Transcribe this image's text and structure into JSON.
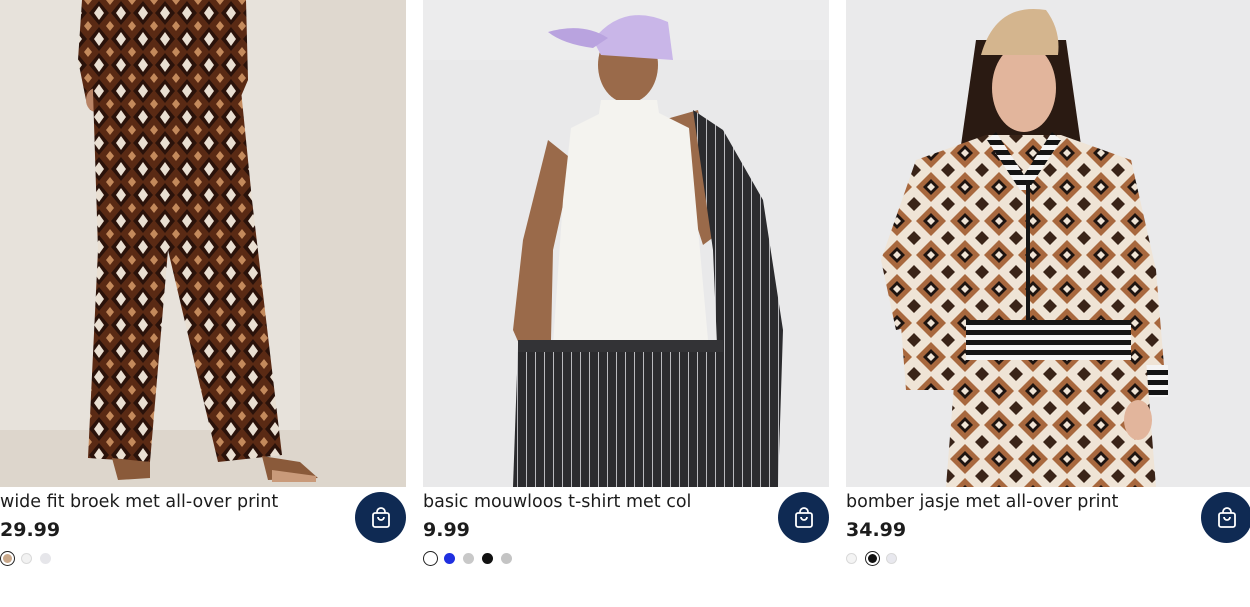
{
  "products": [
    {
      "title": "wide fit broek met all-over print",
      "price": "29.99",
      "image_subject": "model wearing brown geometric print wide-leg trousers and matching top",
      "cart_icon": "shopping-bag-icon",
      "swatches": [
        "#c9a88a",
        "#f2f2f2",
        "#e6e6ea"
      ],
      "selected_swatch": 0
    },
    {
      "title": "basic mouwloos t-shirt met col",
      "price": "9.99",
      "image_subject": "model in lilac cap, white sleeveless turtleneck and pinstripe trousers holding a pinstripe blazer",
      "cart_icon": "shopping-bag-icon",
      "swatches": [
        "#ffffff",
        "#1f2fe0",
        "#c8c8c8",
        "#111111",
        "#c4c4c4"
      ],
      "selected_swatch": 0
    },
    {
      "title": "bomber jasje met all-over print",
      "price": "34.99",
      "image_subject": "model in beige cap wearing brown geometric print bomber jacket with striped ribbed trims",
      "cart_icon": "shopping-bag-icon",
      "swatches": [
        "#f4f4f4",
        "#111111",
        "#e8e8ee"
      ],
      "selected_swatch": 1
    }
  ],
  "colors": {
    "cart_button": "#0f2a53",
    "text": "#1c1c1c"
  }
}
